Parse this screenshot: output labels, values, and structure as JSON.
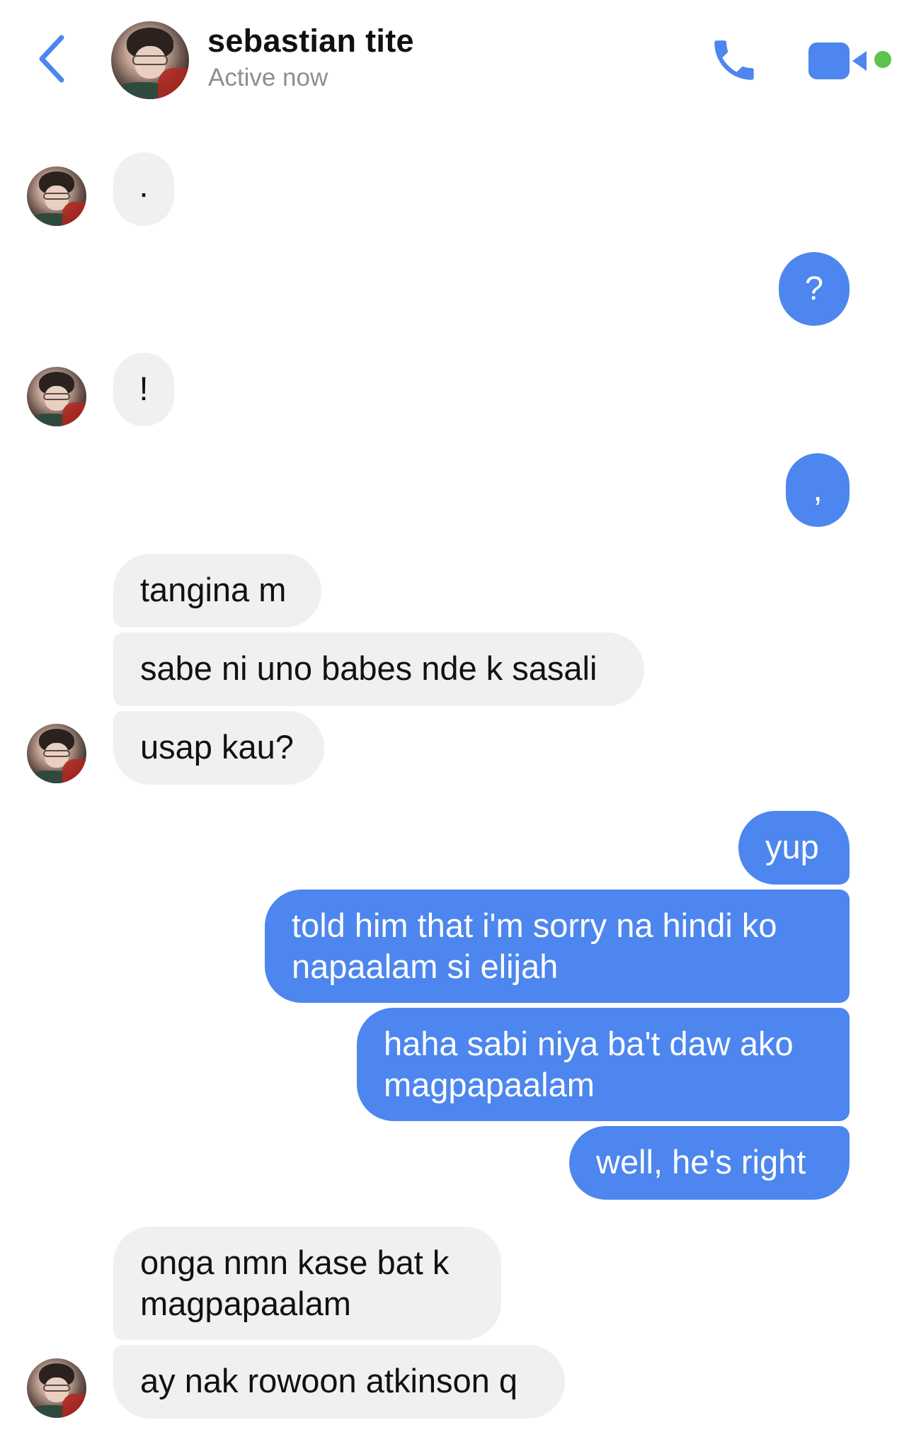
{
  "header": {
    "name": "sebastian tite",
    "status": "Active now",
    "icons": [
      "back-chevron-icon",
      "phone-icon",
      "video-camera-icon"
    ],
    "accent_color": "#4d86ee",
    "online_color": "#5ec24e"
  },
  "messages": [
    {
      "from": "them",
      "lines": [
        "."
      ]
    },
    {
      "from": "me",
      "lines": [
        "?"
      ]
    },
    {
      "from": "them",
      "lines": [
        "!"
      ]
    },
    {
      "from": "me",
      "lines": [
        ","
      ]
    },
    {
      "from": "them",
      "lines": [
        "tangina m"
      ]
    },
    {
      "from": "them",
      "lines": [
        "sabe ni uno babes nde k sasali"
      ]
    },
    {
      "from": "them",
      "lines": [
        "usap kau?"
      ]
    },
    {
      "from": "me",
      "lines": [
        "yup"
      ]
    },
    {
      "from": "me",
      "lines": [
        "told him that i'm sorry na hindi ko",
        "napaalam si elijah"
      ]
    },
    {
      "from": "me",
      "lines": [
        "haha sabi niya ba't daw ako",
        "magpapaalam"
      ]
    },
    {
      "from": "me",
      "lines": [
        "well, he's right"
      ]
    },
    {
      "from": "them",
      "lines": [
        "onga nmn kase bat k",
        "magpapaalam"
      ]
    },
    {
      "from": "them",
      "lines": [
        "ay nak rowoon atkinson q"
      ]
    }
  ],
  "colors": {
    "incoming_bubble": "#f0f0f0",
    "outgoing_bubble": "#4d86ee"
  }
}
